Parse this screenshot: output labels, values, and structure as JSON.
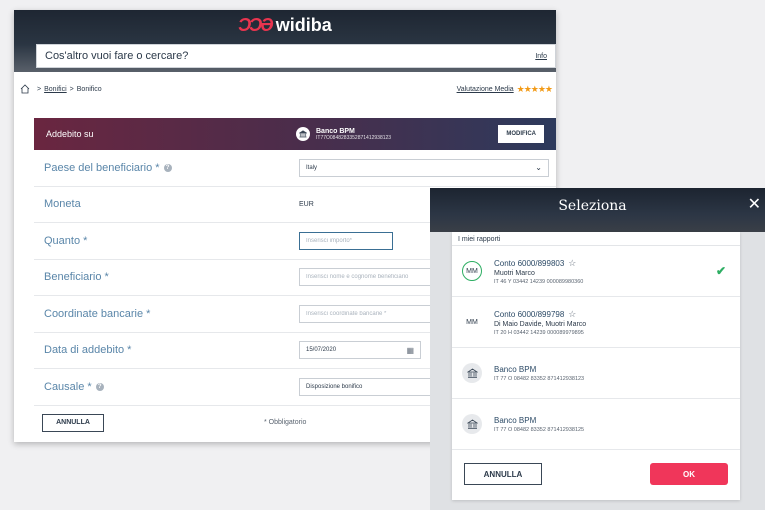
{
  "brand": {
    "name": "widiba",
    "logo_mark": "ƆƆƏ"
  },
  "search": {
    "placeholder": "Cos'altro vuoi fare o cercare?",
    "info": "Info"
  },
  "breadcrumb": {
    "items": [
      "Bonifici",
      "Bonifico"
    ],
    "separator": ">"
  },
  "rating": {
    "label": "Valutazione Media",
    "stars_text": "★★★★★",
    "stars": 5
  },
  "addebito": {
    "label": "Addebito su",
    "bank_name": "Banco BPM",
    "iban": "IT77O0848283352871412938123",
    "modify_label": "MODIFICA"
  },
  "form": {
    "paese": {
      "label": "Paese del beneficiario *",
      "value": "Italy"
    },
    "moneta": {
      "label": "Moneta",
      "value": "EUR"
    },
    "quanto": {
      "label": "Quanto *",
      "placeholder": "Inserisci importo*"
    },
    "beneficiario": {
      "label": "Beneficiario *",
      "placeholder": "Inserisci nome e cognome beneficiario"
    },
    "coordinate": {
      "label": "Coordinate bancarie *",
      "placeholder": "Inserisci coordinate bancarie *"
    },
    "data": {
      "label": "Data di addebito *",
      "value": "15/07/2020"
    },
    "causale": {
      "label": "Causale *",
      "value": "Disposizione bonifico"
    },
    "cancel_label": "ANNULLA",
    "required_note": "* Obbligatorio"
  },
  "modal": {
    "title": "Seleziona",
    "section_label": "I miei rapporti",
    "accounts": [
      {
        "initials": "MM",
        "title": "Conto 6000/899803",
        "owner": "Muotri Marco",
        "iban": "IT 46 Y 03442 14239 000089980360",
        "selected": true
      },
      {
        "initials": "MM",
        "title": "Conto 6000/899798",
        "owner": "Di Maio Davide, Muotri Marco",
        "iban": "IT 20 H 03442 14239 000089979895",
        "selected": false
      },
      {
        "initials": "",
        "title": "Banco BPM",
        "owner": "",
        "iban": "IT 77 O 08482 83352 871412938123",
        "selected": false
      },
      {
        "initials": "",
        "title": "Banco BPM",
        "owner": "",
        "iban": "IT 77 O 08482 83352 871412938125",
        "selected": false
      }
    ],
    "star_glyph": "☆",
    "check_glyph": "✔",
    "cancel_label": "ANNULLA",
    "ok_label": "OK"
  },
  "colors": {
    "accent": "#f0365a",
    "success": "#2eae63",
    "label_blue": "#5a86a9",
    "header_dark": "#1e2632"
  }
}
